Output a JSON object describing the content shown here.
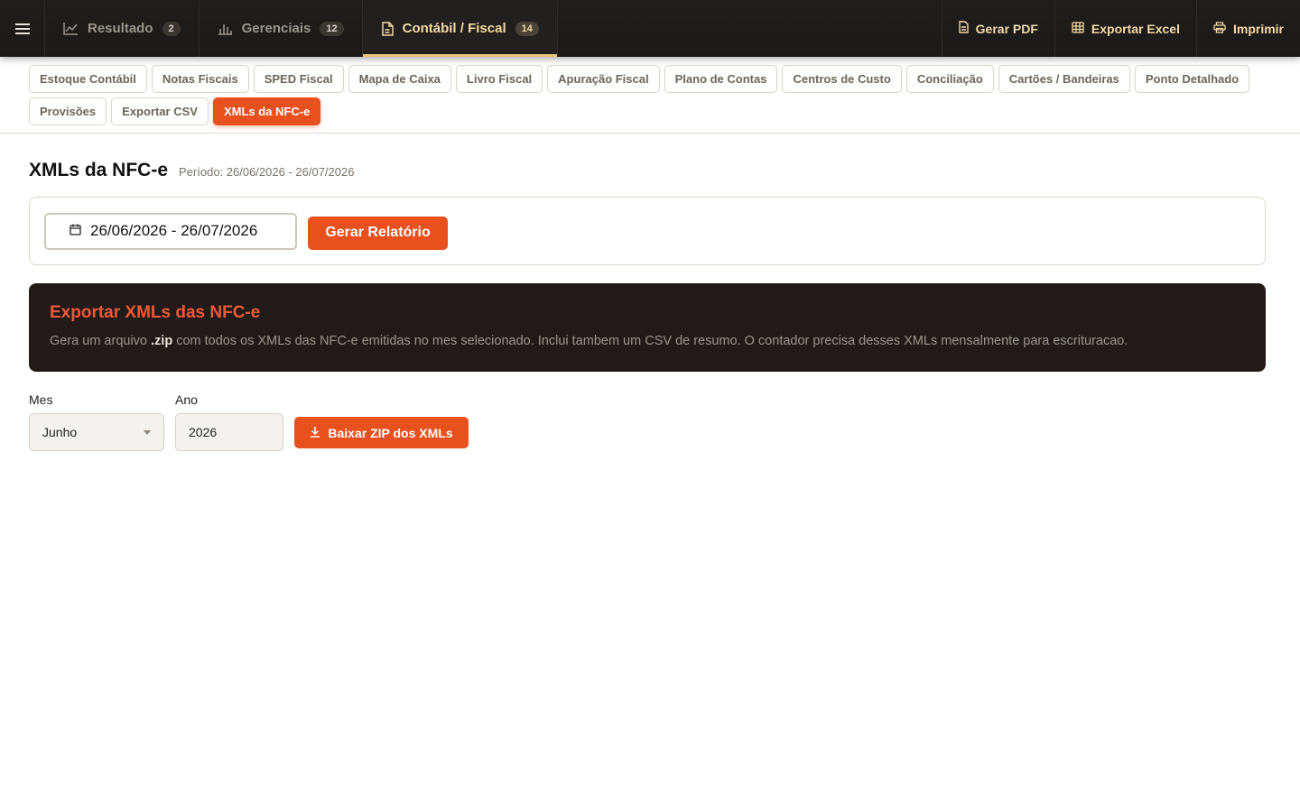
{
  "topbar": {
    "tabs": [
      {
        "label": "Resultado",
        "badge": "2",
        "icon": "line-chart-icon"
      },
      {
        "label": "Gerenciais",
        "badge": "12",
        "icon": "bar-chart-icon"
      },
      {
        "label": "Contábil / Fiscal",
        "badge": "14",
        "icon": "document-icon",
        "active": true
      }
    ],
    "actions": [
      {
        "label": "Gerar PDF",
        "icon": "file-pdf-icon"
      },
      {
        "label": "Exportar Excel",
        "icon": "table-grid-icon"
      },
      {
        "label": "Imprimir",
        "icon": "printer-icon"
      }
    ]
  },
  "subtabs": [
    "Estoque Contábil",
    "Notas Fiscais",
    "SPED Fiscal",
    "Mapa de Caixa",
    "Livro Fiscal",
    "Apuração Fiscal",
    "Plano de Contas",
    "Centros de Custo",
    "Conciliação",
    "Cartões / Bandeiras",
    "Ponto Detalhado",
    "Provisões",
    "Exportar CSV",
    "XMLs da NFC-e"
  ],
  "active_subtab": "XMLs da NFC-e",
  "page": {
    "title": "XMLs da NFC-e",
    "period": "Período: 26/06/2026 - 26/07/2026"
  },
  "filter": {
    "date_range": "26/06/2026 - 26/07/2026",
    "generate_label": "Gerar Relatório"
  },
  "info": {
    "title": "Exportar XMLs das NFC-e",
    "text_before": "Gera um arquivo ",
    "text_bold": ".zip",
    "text_after": " com todos os XMLs das NFC-e emitidas no mes selecionado. Inclui tambem um CSV de resumo. O contador precisa desses XMLs mensalmente para escrituracao."
  },
  "form": {
    "month_label": "Mes",
    "month_value": "Junho",
    "year_label": "Ano",
    "year_value": "2026",
    "download_label": "Baixar ZIP dos XMLs"
  },
  "colors": {
    "accent": "#e8501e",
    "topbar_bg": "#1f1e1d",
    "active_tab_text": "#f5d9a6",
    "info_bg": "#221a19",
    "info_title": "#ee5a37"
  }
}
